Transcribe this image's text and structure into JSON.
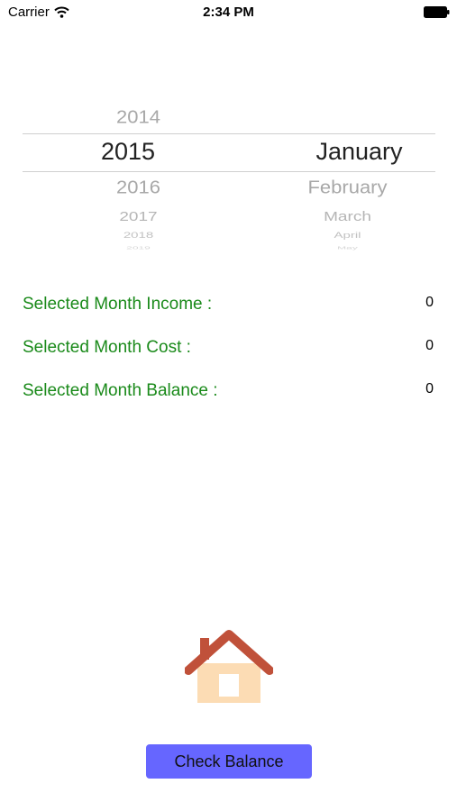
{
  "status_bar": {
    "carrier": "Carrier",
    "time": "2:34 PM"
  },
  "picker": {
    "years": {
      "prev": "2014",
      "selected": "2015",
      "next": [
        "2016",
        "2017",
        "2018",
        "2019"
      ]
    },
    "months": {
      "prev": "",
      "selected": "January",
      "next": [
        "February",
        "March",
        "April",
        "May"
      ]
    }
  },
  "summary": {
    "income_label": "Selected Month Income :",
    "income_value": "0",
    "cost_label": "Selected Month Cost :",
    "cost_value": "0",
    "balance_label": "Selected Month Balance :",
    "balance_value": "0"
  },
  "icons": {
    "home": "home-icon"
  },
  "colors": {
    "label_green": "#1a8a1a",
    "button_bg": "#6666ff",
    "roof": "#c0513a",
    "house_body": "#fcdcb4"
  },
  "actions": {
    "check_balance_label": "Check Balance"
  }
}
